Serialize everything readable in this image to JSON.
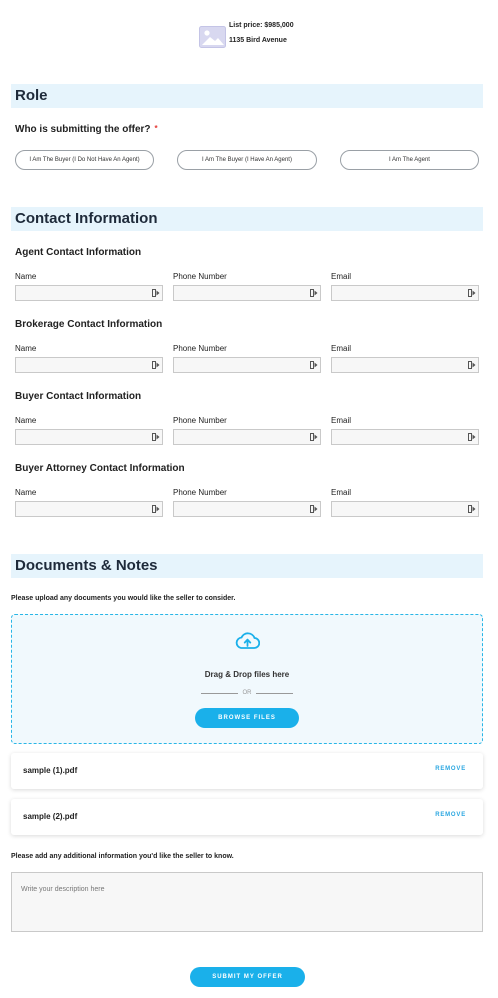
{
  "listing": {
    "price": "List price: $985,000",
    "address": "1135 Bird Avenue"
  },
  "role": {
    "heading": "Role",
    "question": "Who is submitting the offer?",
    "required_mark": "*",
    "options": [
      "I Am The Buyer (I Do Not Have An Agent)",
      "I Am The Buyer (I Have An Agent)",
      "I Am The Agent"
    ]
  },
  "contact": {
    "heading": "Contact Information",
    "groups": [
      {
        "title": "Agent Contact Information"
      },
      {
        "title": "Brokerage Contact Information"
      },
      {
        "title": "Buyer Contact Information"
      },
      {
        "title": "Buyer Attorney Contact Information"
      }
    ],
    "labels": {
      "name": "Name",
      "phone": "Phone Number",
      "email": "Email"
    },
    "field_icon": "autofill-icon"
  },
  "documents": {
    "heading": "Documents & Notes",
    "upload_prompt": "Please upload any documents you would like the seller to consider.",
    "dropzone_text": "Drag & Drop files here",
    "or_text": "OR",
    "browse_label": "BROWSE FILES",
    "upload_icon": "cloud-upload-icon",
    "files": [
      {
        "name": "sample (1).pdf",
        "action": "REMOVE"
      },
      {
        "name": "sample (2).pdf",
        "action": "REMOVE"
      }
    ],
    "notes_prompt": "Please add any additional information you'd like the seller to know.",
    "notes_placeholder": "Write your description here"
  },
  "submit_label": "SUBMIT MY OFFER",
  "colors": {
    "accent": "#1ab0ea",
    "section_bg": "#e6f4fc",
    "required": "#e53935"
  }
}
